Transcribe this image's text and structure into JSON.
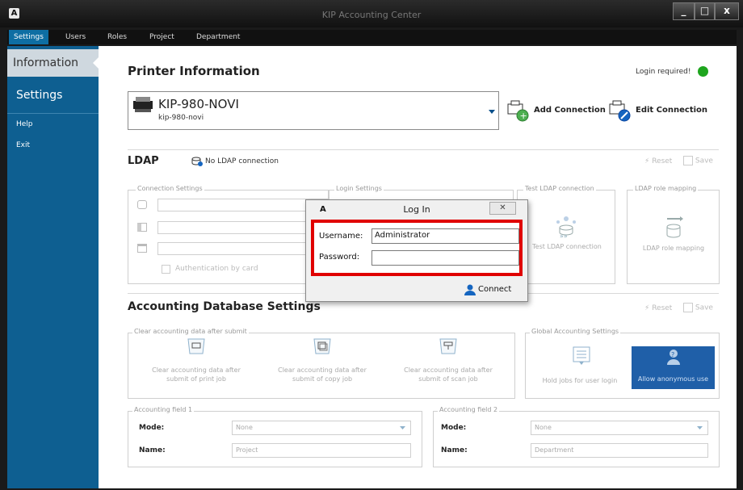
{
  "window": {
    "app_icon_letter": "A",
    "title": "KIP Accounting Center",
    "buttons": [
      "_",
      "□",
      "x"
    ]
  },
  "menu": [
    "Settings",
    "Users",
    "Roles",
    "Project",
    "Department"
  ],
  "sidebar": [
    "Information",
    "Settings",
    "Help",
    "Exit"
  ],
  "printer": {
    "heading": "Printer Information",
    "login_required": "Login required!",
    "login_dot_color": "#1ea51e",
    "name": "KIP-980-NOVI",
    "host": "kip-980-novi",
    "add_connection": "Add Connection",
    "edit_connection": "Edit Connection"
  },
  "ldap": {
    "heading": "LDAP",
    "status": "No LDAP connection",
    "reset": "Reset",
    "save": "Save",
    "connection_settings": "Connection Settings",
    "login_settings": "Login Settings",
    "test_group": "Test LDAP connection",
    "test_button": "Test LDAP connection",
    "role_group": "LDAP role mapping",
    "role_button": "LDAP role mapping",
    "auth_by_card": "Authentication by card"
  },
  "accounting": {
    "heading": "Accounting Database Settings",
    "reset": "Reset",
    "save": "Save",
    "clear_group": "Clear accounting data after submit",
    "clear_print": "Clear accounting data after submit of print job",
    "clear_copy": "Clear accounting data after submit of copy job",
    "clear_scan": "Clear accounting data after submit of scan job",
    "global_group": "Global Accounting Settings",
    "hold_jobs": "Hold jobs for user login",
    "allow_anonymous": "Allow anonymous use",
    "field1": {
      "legend": "Accounting field 1",
      "mode_label": "Mode:",
      "mode_value": "None",
      "name_label": "Name:",
      "name_value": "Project"
    },
    "field2": {
      "legend": "Accounting field 2",
      "mode_label": "Mode:",
      "mode_value": "None",
      "name_label": "Name:",
      "name_value": "Department"
    }
  },
  "login_dialog": {
    "icon_letter": "A",
    "title": "Log In",
    "close": "✕",
    "username_label": "Username:",
    "username_value": "Administrator",
    "password_label": "Password:",
    "password_value": "",
    "connect": "Connect",
    "highlight_color": "#e00000"
  }
}
